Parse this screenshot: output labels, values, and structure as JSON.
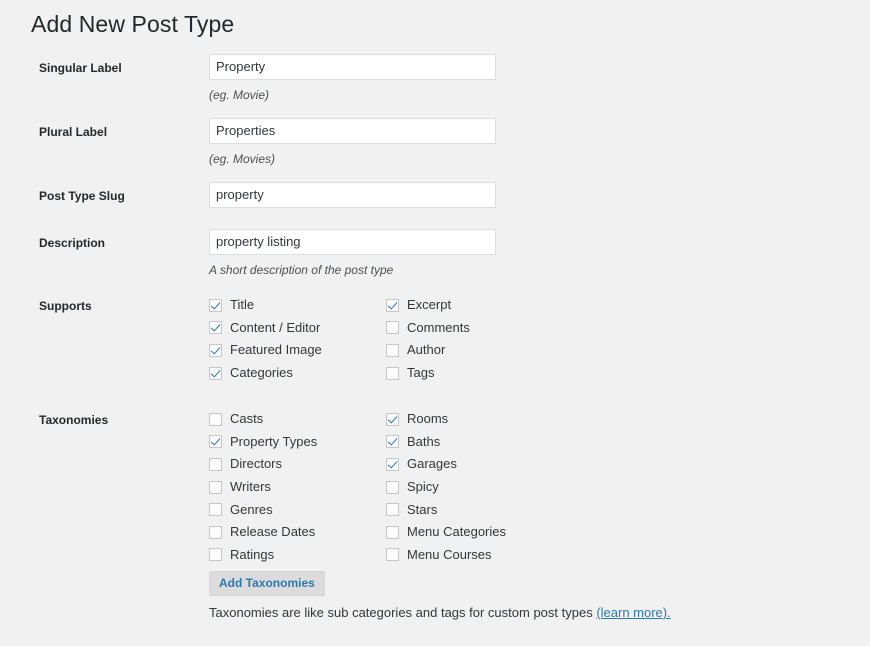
{
  "page": {
    "title": "Add New Post Type"
  },
  "fields": {
    "singular": {
      "label": "Singular Label",
      "value": "Property",
      "hint": "(eg. Movie)"
    },
    "plural": {
      "label": "Plural Label",
      "value": "Properties",
      "hint": "(eg. Movies)"
    },
    "slug": {
      "label": "Post Type Slug",
      "value": "property",
      "hint": ""
    },
    "description": {
      "label": "Description",
      "value": "property listing",
      "hint": "A short description of the post type"
    }
  },
  "supports": {
    "label": "Supports",
    "left": [
      {
        "label": "Title",
        "checked": true
      },
      {
        "label": "Content / Editor",
        "checked": true
      },
      {
        "label": "Featured Image",
        "checked": true
      },
      {
        "label": "Categories",
        "checked": true
      }
    ],
    "right": [
      {
        "label": "Excerpt",
        "checked": true
      },
      {
        "label": "Comments",
        "checked": false
      },
      {
        "label": "Author",
        "checked": false
      },
      {
        "label": "Tags",
        "checked": false
      }
    ]
  },
  "taxonomies": {
    "label": "Taxonomies",
    "left": [
      {
        "label": "Casts",
        "checked": false
      },
      {
        "label": "Property Types",
        "checked": true
      },
      {
        "label": "Directors",
        "checked": false
      },
      {
        "label": "Writers",
        "checked": false
      },
      {
        "label": "Genres",
        "checked": false
      },
      {
        "label": "Release Dates",
        "checked": false
      },
      {
        "label": "Ratings",
        "checked": false
      }
    ],
    "right": [
      {
        "label": "Rooms",
        "checked": true
      },
      {
        "label": "Baths",
        "checked": true
      },
      {
        "label": "Garages",
        "checked": true
      },
      {
        "label": "Spicy",
        "checked": false
      },
      {
        "label": "Stars",
        "checked": false
      },
      {
        "label": "Menu Categories",
        "checked": false
      },
      {
        "label": "Menu Courses",
        "checked": false
      }
    ],
    "add_button": "Add Taxonomies",
    "footnote_text": "Taxonomies are like sub categories and tags for custom post types ",
    "footnote_link": "(learn more)."
  },
  "colors": {
    "background": "#f1f1f1",
    "accent": "#2a7ab0",
    "text": "#32373c",
    "input_border": "#dedede",
    "button_bg": "#dcdcdc"
  }
}
